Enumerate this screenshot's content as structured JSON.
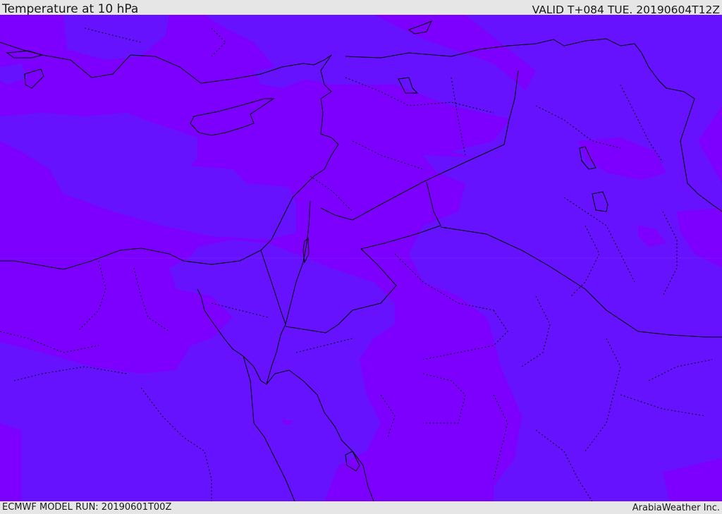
{
  "header": {
    "title": "Temperature at 10 hPa",
    "valid": "VALID T+084 TUE. 20190604T12Z"
  },
  "footer": {
    "model_run": "ECMWF MODEL RUN: 20190601T00Z",
    "credit": "ArabiaWeather Inc."
  },
  "map": {
    "fill_colors": {
      "violet": "#7d00ff",
      "blue_violet": "#6612ff"
    },
    "coastline_color": "#000000",
    "border_style": "dotted"
  }
}
